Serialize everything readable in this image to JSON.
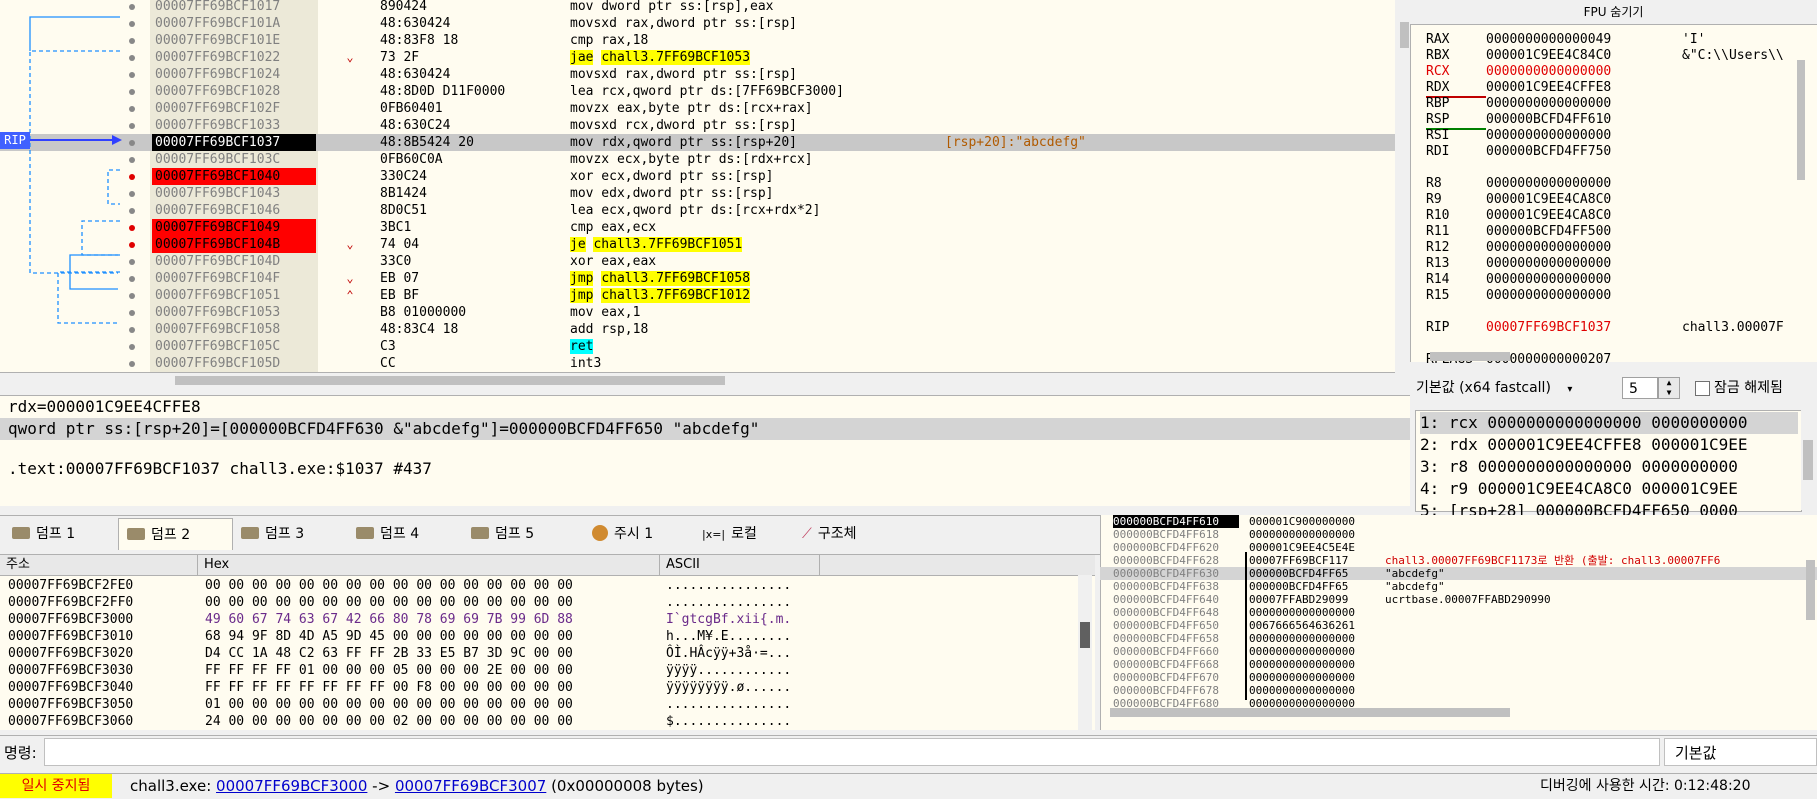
{
  "disasm": {
    "rip_label": "RIP",
    "rows": [
      {
        "addr": "00007FF69BCF1017",
        "bytes": "890424",
        "asm": "mov dword ptr ss:[rsp],eax",
        "bp": false,
        "arrow": ""
      },
      {
        "addr": "00007FF69BCF101A",
        "bytes": "48:630424",
        "asm": "movsxd rax,dword ptr ss:[rsp]",
        "bp": false,
        "arrow": ""
      },
      {
        "addr": "00007FF69BCF101E",
        "bytes": "48:83F8 18",
        "asm": "cmp rax,18",
        "bp": false,
        "arrow": ""
      },
      {
        "addr": "00007FF69BCF1022",
        "bytes": "73 2F",
        "asm": "jae chall3.7FF69BCF1053",
        "bp": false,
        "arrow": "v"
      },
      {
        "addr": "00007FF69BCF1024",
        "bytes": "48:630424",
        "asm": "movsxd rax,dword ptr ss:[rsp]",
        "bp": false,
        "arrow": ""
      },
      {
        "addr": "00007FF69BCF1028",
        "bytes": "48:8D0D D11F0000",
        "asm": "lea rcx,qword ptr ds:[7FF69BCF3000]",
        "bp": false,
        "arrow": ""
      },
      {
        "addr": "00007FF69BCF102F",
        "bytes": "0FB60401",
        "asm": "movzx eax,byte ptr ds:[rcx+rax]",
        "bp": false,
        "arrow": ""
      },
      {
        "addr": "00007FF69BCF1033",
        "bytes": "48:630C24",
        "asm": "movsxd rcx,dword ptr ss:[rsp]",
        "bp": false,
        "arrow": ""
      },
      {
        "addr": "00007FF69BCF1037",
        "bytes": "48:8B5424 20",
        "asm": "mov rdx,qword ptr ss:[rsp+20]",
        "bp": false,
        "arrow": "",
        "cur": true,
        "comment": "[rsp+20]:\"abcdefg\""
      },
      {
        "addr": "00007FF69BCF103C",
        "bytes": "0FB60C0A",
        "asm": "movzx ecx,byte ptr ds:[rdx+rcx]",
        "bp": false,
        "arrow": ""
      },
      {
        "addr": "00007FF69BCF1040",
        "bytes": "330C24",
        "asm": "xor ecx,dword ptr ss:[rsp]",
        "bp": true,
        "arrow": ""
      },
      {
        "addr": "00007FF69BCF1043",
        "bytes": "8B1424",
        "asm": "mov edx,dword ptr ss:[rsp]",
        "bp": false,
        "arrow": ""
      },
      {
        "addr": "00007FF69BCF1046",
        "bytes": "8D0C51",
        "asm": "lea ecx,qword ptr ds:[rcx+rdx*2]",
        "bp": false,
        "arrow": ""
      },
      {
        "addr": "00007FF69BCF1049",
        "bytes": "3BC1",
        "asm": "cmp eax,ecx",
        "bp": true,
        "arrow": ""
      },
      {
        "addr": "00007FF69BCF104B",
        "bytes": "74 04",
        "asm": "je chall3.7FF69BCF1051",
        "bp": true,
        "arrow": "v"
      },
      {
        "addr": "00007FF69BCF104D",
        "bytes": "33C0",
        "asm": "xor eax,eax",
        "bp": false,
        "arrow": ""
      },
      {
        "addr": "00007FF69BCF104F",
        "bytes": "EB 07",
        "asm": "jmp chall3.7FF69BCF1058",
        "bp": false,
        "arrow": "v"
      },
      {
        "addr": "00007FF69BCF1051",
        "bytes": "EB BF",
        "asm": "jmp chall3.7FF69BCF1012",
        "bp": false,
        "arrow": "^"
      },
      {
        "addr": "00007FF69BCF1053",
        "bytes": "B8 01000000",
        "asm": "mov eax,1",
        "bp": false,
        "arrow": ""
      },
      {
        "addr": "00007FF69BCF1058",
        "bytes": "48:83C4 18",
        "asm": "add rsp,18",
        "bp": false,
        "arrow": ""
      },
      {
        "addr": "00007FF69BCF105C",
        "bytes": "C3",
        "asm": "ret",
        "bp": false,
        "arrow": ""
      },
      {
        "addr": "00007FF69BCF105D",
        "bytes": "CC",
        "asm": "int3",
        "bp": false,
        "arrow": ""
      }
    ]
  },
  "fpu": {
    "header": "FPU 숨기기"
  },
  "registers": [
    {
      "name": "RAX",
      "value": "0000000000000049",
      "comment": "'I'",
      "changed": false
    },
    {
      "name": "RBX",
      "value": "000001C9EE4C84C0",
      "comment": "&\"C:\\\\Users\\\\",
      "changed": false
    },
    {
      "name": "RCX",
      "value": "0000000000000000",
      "comment": "",
      "changed": true
    },
    {
      "name": "RDX",
      "value": "000001C9EE4CFFE8",
      "comment": "",
      "changed": false
    },
    {
      "name": "RBP",
      "value": "0000000000000000",
      "comment": "",
      "changed": false
    },
    {
      "name": "RSP",
      "value": "000000BCFD4FF610",
      "comment": "",
      "changed": false
    },
    {
      "name": "RSI",
      "value": "0000000000000000",
      "comment": "",
      "changed": false
    },
    {
      "name": "RDI",
      "value": "000000BCFD4FF750",
      "comment": "",
      "changed": false
    },
    {
      "name": "",
      "value": "",
      "comment": "",
      "changed": false
    },
    {
      "name": "R8",
      "value": "0000000000000000",
      "comment": "",
      "changed": false
    },
    {
      "name": "R9",
      "value": "000001C9EE4CA8C0",
      "comment": "",
      "changed": false
    },
    {
      "name": "R10",
      "value": "000001C9EE4CA8C0",
      "comment": "",
      "changed": false
    },
    {
      "name": "R11",
      "value": "000000BCFD4FF500",
      "comment": "",
      "changed": false
    },
    {
      "name": "R12",
      "value": "0000000000000000",
      "comment": "",
      "changed": false
    },
    {
      "name": "R13",
      "value": "0000000000000000",
      "comment": "",
      "changed": false
    },
    {
      "name": "R14",
      "value": "0000000000000000",
      "comment": "",
      "changed": false
    },
    {
      "name": "R15",
      "value": "0000000000000000",
      "comment": "",
      "changed": false
    },
    {
      "name": "",
      "value": "",
      "comment": "",
      "changed": false
    },
    {
      "name": "RIP",
      "value": "00007FF69BCF1037",
      "comment": "chall3.00007F",
      "changed": true
    },
    {
      "name": "",
      "value": "",
      "comment": "",
      "changed": false
    },
    {
      "name": "RFLAGS",
      "value": "0000000000000207",
      "comment": "",
      "changed": false
    }
  ],
  "callconv": {
    "selected": "기본값 (x64 fastcall)",
    "count": "5",
    "unlock_label": "잠금 해제됨"
  },
  "args": [
    "1: rcx 0000000000000000 0000000000",
    "2: rdx 000001C9EE4CFFE8 000001C9EE",
    "3: r8 0000000000000000 0000000000",
    "4: r9 000001C9EE4CA8C0 000001C9EE",
    "5: [rsp+28] 000000BCFD4FF650 0000"
  ],
  "info": {
    "line1": "rdx=000001C9EE4CFFE8",
    "line2": "qword ptr ss:[rsp+20]=[000000BCFD4FF630 &\"abcdefg\"]=000000BCFD4FF650 \"abcdefg\"",
    "line3": ".text:00007FF69BCF1037 chall3.exe:$1037 #437"
  },
  "dump_tabs": [
    "덤프 1",
    "덤프 2",
    "덤프 3",
    "덤프 4",
    "덤프 5",
    "주시 1",
    "로컬",
    "구조체"
  ],
  "dump": {
    "headers": [
      "주소",
      "Hex",
      "ASCII"
    ],
    "rows": [
      {
        "addr": "00007FF69BCF2FE0",
        "hex": "00 00 00 00 00 00 00 00 00 00 00 00 00 00 00 00",
        "ascii": "................"
      },
      {
        "addr": "00007FF69BCF2FF0",
        "hex": "00 00 00 00 00 00 00 00 00 00 00 00 00 00 00 00",
        "ascii": "................"
      },
      {
        "addr": "00007FF69BCF3000",
        "hex": "49 60 67 74 63 67 42 66 80 78 69 69 7B 99 6D 88",
        "ascii": "I`gtcgBf.xii{.m."
      },
      {
        "addr": "00007FF69BCF3010",
        "hex": "68 94 9F 8D 4D A5 9D 45 00 00 00 00 00 00 00 00",
        "ascii": "h...M¥.E........"
      },
      {
        "addr": "00007FF69BCF3020",
        "hex": "D4 CC 1A 48 C2 63 FF FF 2B 33 E5 B7 3D 9C 00 00",
        "ascii": "ÔÌ.HÂcÿÿ+3å·=..."
      },
      {
        "addr": "00007FF69BCF3030",
        "hex": "FF FF FF FF 01 00 00 00 05 00 00 00 2E 00 00 00",
        "ascii": "ÿÿÿÿ............"
      },
      {
        "addr": "00007FF69BCF3040",
        "hex": "FF FF FF FF FF FF FF FF 00 F8 00 00 00 00 00 00",
        "ascii": "ÿÿÿÿÿÿÿÿ.ø......"
      },
      {
        "addr": "00007FF69BCF3050",
        "hex": "01 00 00 00 00 00 00 00 00 00 00 00 00 00 00 00",
        "ascii": "................"
      },
      {
        "addr": "00007FF69BCF3060",
        "hex": "24 00 00 00 00 00 00 00 02 00 00 00 00 00 00 00",
        "ascii": "$..............."
      }
    ]
  },
  "stack": [
    {
      "addr": "000000BCFD4FF610",
      "value": "000001C900000000",
      "comment": "",
      "cur": true
    },
    {
      "addr": "000000BCFD4FF618",
      "value": "0000000000000000",
      "comment": ""
    },
    {
      "addr": "000000BCFD4FF620",
      "value": "000001C9EE4C5E4E",
      "comment": ""
    },
    {
      "addr": "000000BCFD4FF628",
      "value": "00007FF69BCF117",
      "comment": "chall3.00007FF69BCF1173로 반환 (출발: chall3.00007FF6",
      "ret": true
    },
    {
      "addr": "000000BCFD4FF630",
      "value": "000000BCFD4FF65",
      "comment": "\"abcdefg\"",
      "sel": true
    },
    {
      "addr": "000000BCFD4FF638",
      "value": "000000BCFD4FF65",
      "comment": "\"abcdefg\""
    },
    {
      "addr": "000000BCFD4FF640",
      "value": "00007FFABD29099",
      "comment": "ucrtbase.00007FFABD290990"
    },
    {
      "addr": "000000BCFD4FF648",
      "value": "0000000000000000",
      "comment": ""
    },
    {
      "addr": "000000BCFD4FF650",
      "value": "0067666564636261",
      "comment": ""
    },
    {
      "addr": "000000BCFD4FF658",
      "value": "0000000000000000",
      "comment": ""
    },
    {
      "addr": "000000BCFD4FF660",
      "value": "0000000000000000",
      "comment": ""
    },
    {
      "addr": "000000BCFD4FF668",
      "value": "0000000000000000",
      "comment": ""
    },
    {
      "addr": "000000BCFD4FF670",
      "value": "0000000000000000",
      "comment": ""
    },
    {
      "addr": "000000BCFD4FF678",
      "value": "0000000000000000",
      "comment": ""
    },
    {
      "addr": "000000BCFD4FF680",
      "value": "0000000000000000",
      "comment": ""
    }
  ],
  "command": {
    "label": "명령:",
    "default": "기본값"
  },
  "status": {
    "paused": "일시 중지됨",
    "prefix": "chall3.exe: ",
    "from": "00007FF69BCF3000",
    "sep": " -> ",
    "to": "00007FF69BCF3007",
    "size": " (0x00000008 bytes)",
    "time": "디버깅에 사용한 시간: 0:12:48:20"
  }
}
